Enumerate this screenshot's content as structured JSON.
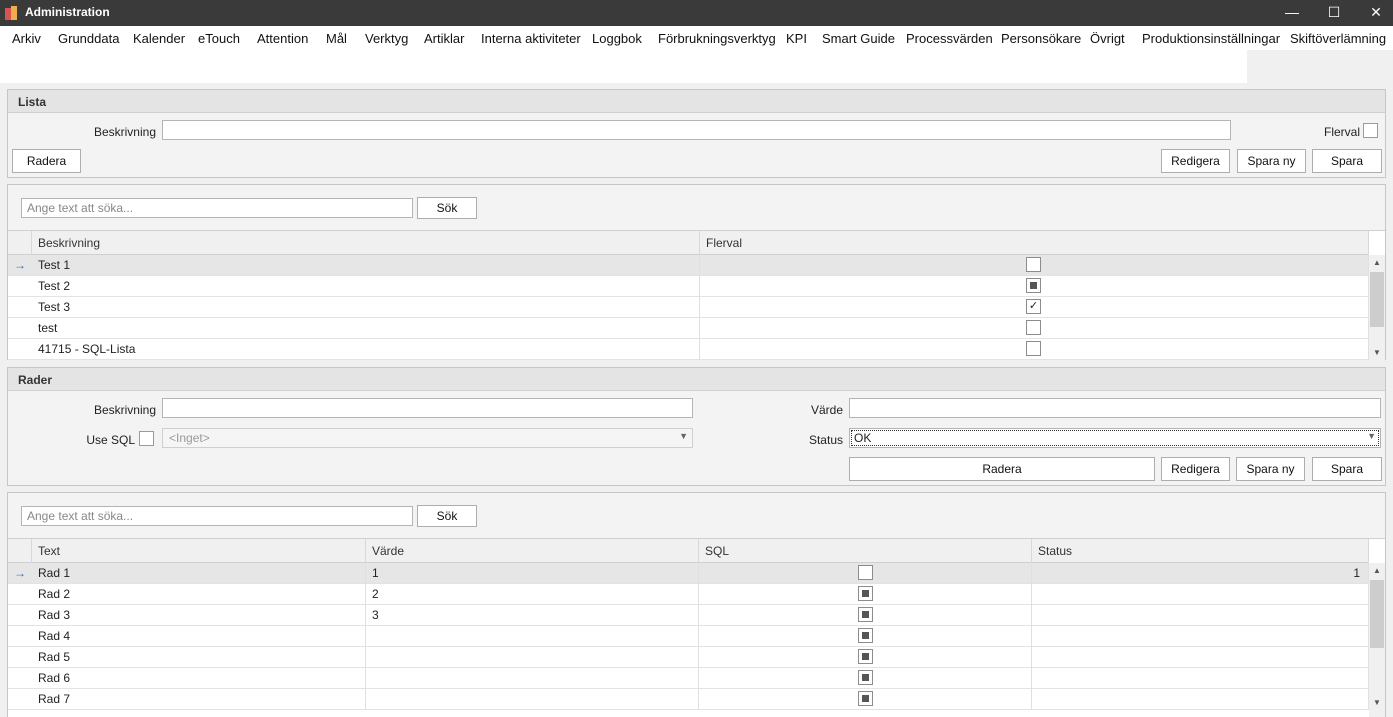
{
  "window": {
    "title": "Administration",
    "minimize": "—",
    "maximize": "☐",
    "close": "✕"
  },
  "menu": [
    "Arkiv",
    "Grunddata",
    "Kalender",
    "eTouch",
    "Attention",
    "Mål",
    "Verktyg",
    "Artiklar",
    "Interna aktiviteter",
    "Loggbok",
    "Förbrukningsverktyg",
    "KPI",
    "Smart Guide",
    "Processvärden",
    "Personsökare",
    "Övrigt",
    "Produktionsinställningar",
    "Skiftöverlämning"
  ],
  "lista": {
    "header": "Lista",
    "beskrivning_label": "Beskrivning",
    "beskrivning_value": "",
    "flerval_label": "Flerval",
    "btn_radera": "Radera",
    "btn_redigera": "Redigera",
    "btn_spara_ny": "Spara ny",
    "btn_spara": "Spara"
  },
  "list_grid": {
    "search_placeholder": "Ange text att söka...",
    "search_button": "Sök",
    "columns": [
      "Beskrivning",
      "Flerval"
    ],
    "rows": [
      {
        "beskrivning": "Test 1",
        "flerval": "unchecked",
        "selected": true
      },
      {
        "beskrivning": "Test 2",
        "flerval": "indeterminate",
        "selected": false
      },
      {
        "beskrivning": "Test 3",
        "flerval": "checked",
        "selected": false
      },
      {
        "beskrivning": "test",
        "flerval": "unchecked",
        "selected": false
      },
      {
        "beskrivning": "41715 - SQL-Lista",
        "flerval": "unchecked",
        "selected": false
      }
    ]
  },
  "rader": {
    "header": "Rader",
    "beskrivning_label": "Beskrivning",
    "beskrivning_value": "",
    "use_sql_label": "Use SQL",
    "sql_combo_value": "<Inget>",
    "varde_label": "Värde",
    "varde_value": "",
    "status_label": "Status",
    "status_value": "OK",
    "btn_radera": "Radera",
    "btn_redigera": "Redigera",
    "btn_spara_ny": "Spara ny",
    "btn_spara": "Spara"
  },
  "rows_grid": {
    "search_placeholder": "Ange text att söka...",
    "search_button": "Sök",
    "columns": [
      "Text",
      "Värde",
      "SQL",
      "Status"
    ],
    "rows": [
      {
        "text": "Rad 1",
        "varde": "1",
        "sql": "unchecked",
        "status": "1",
        "selected": true
      },
      {
        "text": "Rad 2",
        "varde": "2",
        "sql": "indeterminate",
        "status": "",
        "selected": false
      },
      {
        "text": "Rad 3",
        "varde": "3",
        "sql": "indeterminate",
        "status": "",
        "selected": false
      },
      {
        "text": "Rad 4",
        "varde": "",
        "sql": "indeterminate",
        "status": "",
        "selected": false
      },
      {
        "text": "Rad 5",
        "varde": "",
        "sql": "indeterminate",
        "status": "",
        "selected": false
      },
      {
        "text": "Rad 6",
        "varde": "",
        "sql": "indeterminate",
        "status": "",
        "selected": false
      },
      {
        "text": "Rad 7",
        "varde": "",
        "sql": "indeterminate",
        "status": "",
        "selected": false
      }
    ]
  },
  "colors": {
    "titlebar": "#3a3a3a",
    "selected_row": "#e6e6e6",
    "indicator": "#2d6cc0"
  }
}
